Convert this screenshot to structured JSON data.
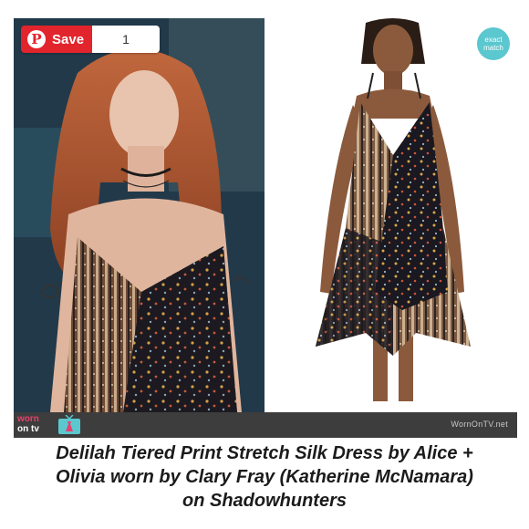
{
  "pin": {
    "save_label": "Save",
    "count": "1",
    "pinterest_logo": "pinterest-p-icon"
  },
  "badge": {
    "line1": "exact",
    "line2": "match"
  },
  "footer": {
    "logo_word1": "worn",
    "logo_word2": "on tv",
    "url": "WornOnTV.net"
  },
  "caption": {
    "line1": "Delilah Tiered Print Stretch Silk Dress by Alice +",
    "line2": "Olivia worn by Clary Fray (Katherine McNamara)",
    "line3": "on Shadowhunters"
  },
  "colors": {
    "pinterest_red": "#e2242c",
    "badge_teal": "#5bc7cf",
    "footer_bg": "#3d3d3d",
    "logo_pink": "#e8406e"
  }
}
